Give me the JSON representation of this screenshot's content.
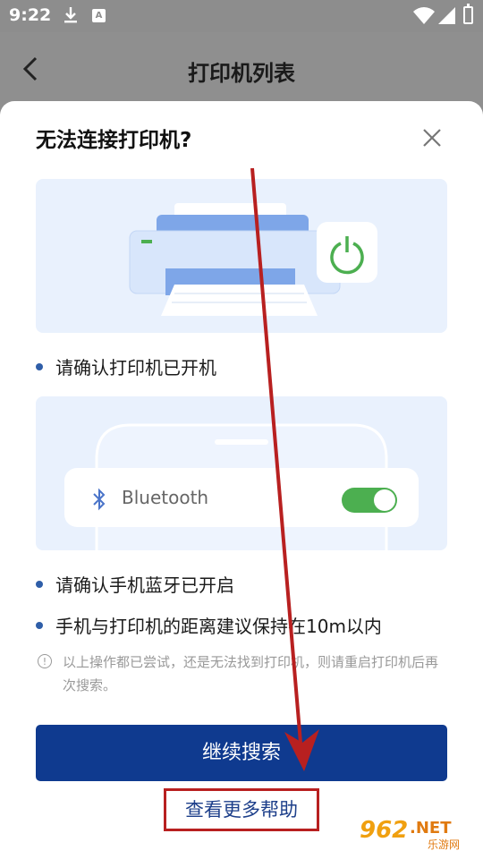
{
  "status_bar": {
    "time": "9:22",
    "notification_letter": "A"
  },
  "header": {
    "title": "打印机列表"
  },
  "dialog": {
    "title": "无法连接打印机?",
    "step1": "请确认打印机已开机",
    "bluetooth_label": "Bluetooth",
    "step2": "请确认手机蓝牙已开启",
    "step3": "手机与打印机的距离建议保持在10m以内",
    "note": "以上操作都已尝试，还是无法找到打印机，则请重启打印机后再次搜索。",
    "note_icon": "!",
    "continue_button": "继续搜索",
    "help_link": "查看更多帮助"
  },
  "watermark": {
    "number": "962",
    "suffix": ".NET",
    "sub": "乐游网"
  },
  "colors": {
    "primary": "#0f3a8f",
    "annotation": "#b82020",
    "toggle_on": "#4caf50",
    "card_bg": "#e9f1fd"
  }
}
